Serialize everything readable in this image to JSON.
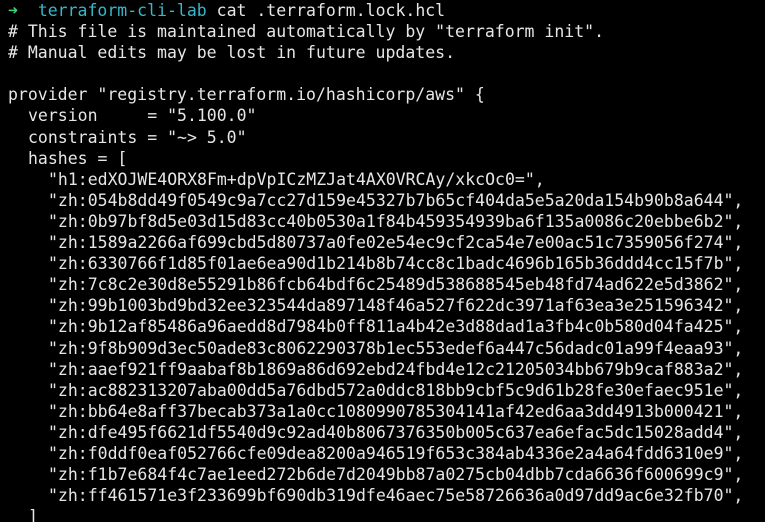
{
  "prompt": {
    "arrow": "➜",
    "directory": "terraform-cli-lab",
    "command": "cat .terraform.lock.hcl"
  },
  "comments": [
    "# This file is maintained automatically by \"terraform init\".",
    "# Manual edits may be lost in future updates."
  ],
  "provider": {
    "open_line": "provider \"registry.terraform.io/hashicorp/aws\" {",
    "version_line": "version     = \"5.100.0\"",
    "constraints_line": "constraints = \"~> 5.0\"",
    "hashes_open": "hashes = [",
    "hashes": [
      "\"h1:edXOJWE4ORX8Fm+dpVpICzMZJat4AX0VRCAy/xkcOc0=\",",
      "\"zh:054b8dd49f0549c9a7cc27d159e45327b7b65cf404da5e5a20da154b90b8a644\",",
      "\"zh:0b97bf8d5e03d15d83cc40b0530a1f84b459354939ba6f135a0086c20ebbe6b2\",",
      "\"zh:1589a2266af699cbd5d80737a0fe02e54ec9cf2ca54e7e00ac51c7359056f274\",",
      "\"zh:6330766f1d85f01ae6ea90d1b214b8b74cc8c1badc4696b165b36ddd4cc15f7b\",",
      "\"zh:7c8c2e30d8e55291b86fcb64bdf6c25489d538688545eb48fd74ad622e5d3862\",",
      "\"zh:99b1003bd9bd32ee323544da897148f46a527f622dc3971af63ea3e251596342\",",
      "\"zh:9b12af85486a96aedd8d7984b0ff811a4b42e3d88dad1a3fb4c0b580d04fa425\",",
      "\"zh:9f8b909d3ec50ade83c8062290378b1ec553edef6a447c56dadc01a99f4eaa93\",",
      "\"zh:aaef921ff9aabaf8b1869a86d692ebd24fbd4e12c21205034bb679b9caf883a2\",",
      "\"zh:ac882313207aba00dd5a76dbd572a0ddc818bb9cbf5c9d61b28fe30efaec951e\",",
      "\"zh:bb64e8aff37becab373a1a0cc1080990785304141af42ed6aa3dd4913b000421\",",
      "\"zh:dfe495f6621df5540d9c92ad40b8067376350b005c637ea6efac5dc15028add4\",",
      "\"zh:f0ddf0eaf052766cfe09dea8200a946519f653c384ab4336e2a4a64fdd6310e9\",",
      "\"zh:f1b7e684f4c7ae1eed272b6de7d2049bb87a0275cb04dbb7cda6636f600699c9\",",
      "\"zh:ff461571e3f233699bf690db319dfe46aec75e58726636a0d97dd9ac6e32fb70\","
    ],
    "hashes_close": "]",
    "close_line": "}"
  },
  "colors": {
    "background": "#000000",
    "text": "#e6e6e6",
    "prompt_arrow": "#43d17a",
    "prompt_directory": "#39b6c9"
  }
}
